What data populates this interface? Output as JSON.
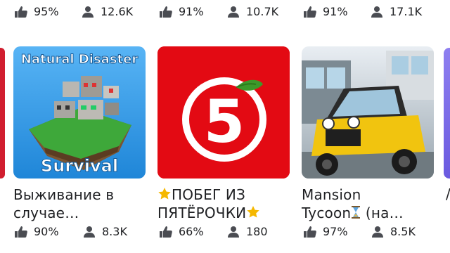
{
  "top_row": [
    {
      "rating": "95%",
      "players": "12.6K"
    },
    {
      "rating": "91%",
      "players": "10.7K"
    },
    {
      "rating": "91%",
      "players": "17.1K"
    }
  ],
  "games": [
    {
      "thumb_top_text": "Natural Disaster",
      "thumb_bottom_text": "Survival",
      "title_line1": "Выживание в",
      "title_line2": "случае…",
      "rating": "90%",
      "players": "8.3K"
    },
    {
      "thumb_logo_text": "5",
      "title_line1": "ПОБЕГ ИЗ",
      "title_line2": "ПЯТЁРОЧКИ",
      "rating": "66%",
      "players": "180"
    },
    {
      "title_line1": "Mansion",
      "title_line2": "Tycoon",
      "title_line2_suffix": " (на…",
      "rating": "97%",
      "players": "8.5K"
    }
  ],
  "colors": {
    "accent_red": "#e30a13",
    "sky_blue": "#3aa0f0",
    "card_blue": "#1d8ad4",
    "taxi_yellow": "#f1c40f"
  },
  "icons": {
    "rating": "thumbs-up-icon",
    "players": "person-icon",
    "hourglass": "hourglass-icon",
    "star": "star-icon"
  }
}
